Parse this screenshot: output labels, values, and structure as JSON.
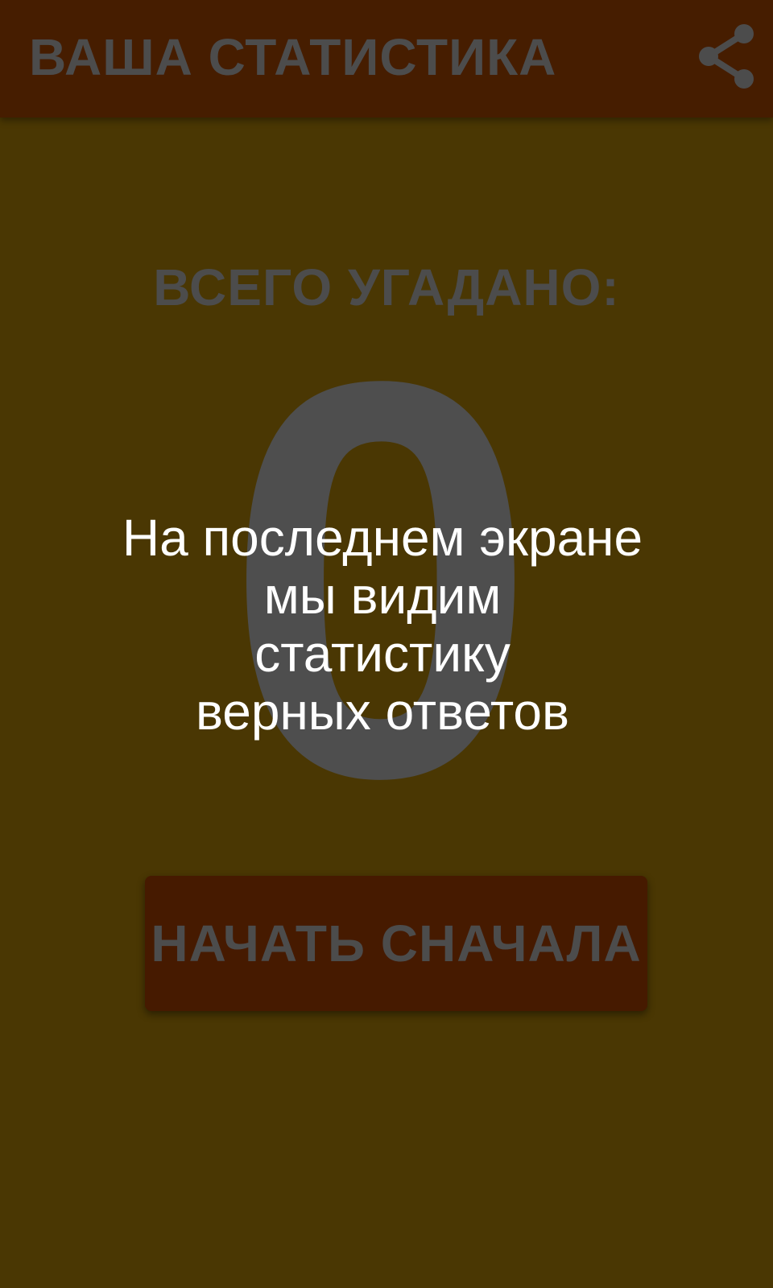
{
  "app_bar": {
    "title": "ВАША СТАТИСТИКА",
    "share_icon": "share-icon"
  },
  "stats": {
    "label": "ВСЕГО УГАДАНО:",
    "count": "0"
  },
  "overlay": {
    "lines": [
      "На последнем экране",
      "мы видим",
      "статистику",
      "верных ответов"
    ]
  },
  "restart_button": {
    "label": "НАЧАТЬ СНАЧАЛА"
  },
  "colors": {
    "background": "#4a3703",
    "app_bar": "#461d00",
    "button": "#461a00",
    "muted_text": "#4c4c4c",
    "overlay_text": "#ffffff"
  }
}
